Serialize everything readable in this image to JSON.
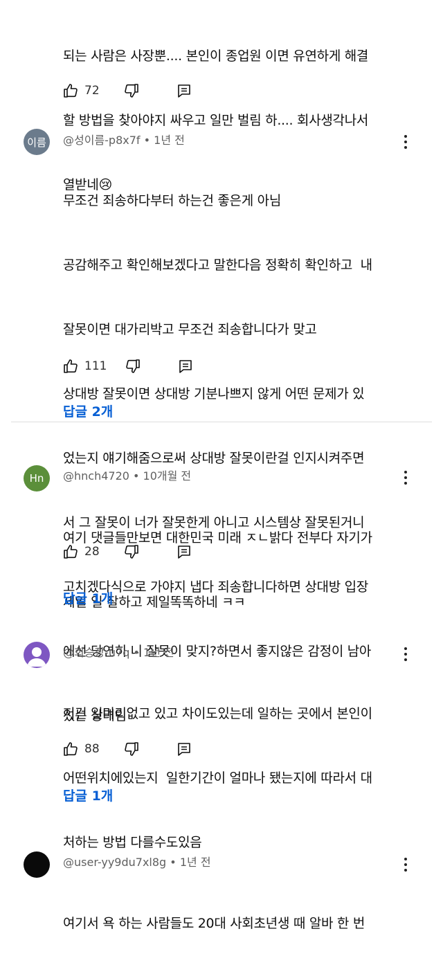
{
  "comments": [
    {
      "avatar_text": "",
      "author": "",
      "time": "",
      "lines": [
        "되는 사람은 사장뿐.... 본인이 종업원 이면 유연하게 해결",
        "할 방법을 찾아야지 싸우고 일만 벌림 하.... 회사생각나서",
        "열받네😢"
      ],
      "likes": "72",
      "replies": ""
    },
    {
      "avatar_text": "이름",
      "avatar_color": "#6b7b8c",
      "author": "@성이름-p8x7f",
      "time": "1년 전",
      "lines": [
        "무조건 죄송하다부터 하는건 좋은게 아님",
        "공감해주고 확인해보겠다고 말한다음 정확히 확인하고  내",
        "잘못이면 대가리박고 무조건 죄송합니다가 맞고",
        "상대방 잘못이면 상대방 기분나쁘지 않게 어떤 문제가 있",
        "었는지 얘기해줌으로써 상대방 잘못이란걸 인지시켜주면",
        "서 그 잘못이 너가 잘못한게 아니고 시스템상 잘못된거니",
        "고치겠다식으로 가야지 냅다 죄송합니다하면 상대방 입장",
        "에선 당연히 니 잘못이 맞지?하면서 좋지않은 감정이 남아",
        "있는 상태임"
      ],
      "likes": "111",
      "replies": "답글 2개"
    },
    {
      "avatar_text": "Hn",
      "avatar_color": "#5b8f3a",
      "author": "@hnch4720",
      "time": "10개월 전",
      "lines": [
        "여기 댓글들만보면 대한민국 미래 ㅈㄴ밝다 전부다 자기가",
        "제일 일 잘하고 제일똑똑하네 ㅋㅋ"
      ],
      "likes": "28",
      "replies": "답글 1개"
    },
    {
      "avatar_text": "",
      "avatar_color": "#7e57c2",
      "author": "@희승장-u7q",
      "time": "1년 전",
      "lines": [
        "저건 일머리없고 있고 차이도있는데 일하는 곳에서 본인이",
        "어떤위치에있는지  일한기간이 얼마나 됐는지에 따라서 대",
        "처하는 방법 다를수도있음"
      ],
      "likes": "88",
      "replies": "답글 1개"
    },
    {
      "avatar_text": "",
      "avatar_color": "#0a0a0a",
      "author": "@user-yy9du7xl8g",
      "time": "1년 전",
      "lines": [
        "여기서 욕 하는 사람들도 20대 사회초년생 때 알바 한 번"
      ],
      "likes": "",
      "replies": ""
    }
  ],
  "meta_separator": " • ",
  "icons": {
    "like": "thumbs-up-icon",
    "dislike": "thumbs-down-icon",
    "reply": "comment-reply-icon",
    "more": "more-vert-icon"
  }
}
